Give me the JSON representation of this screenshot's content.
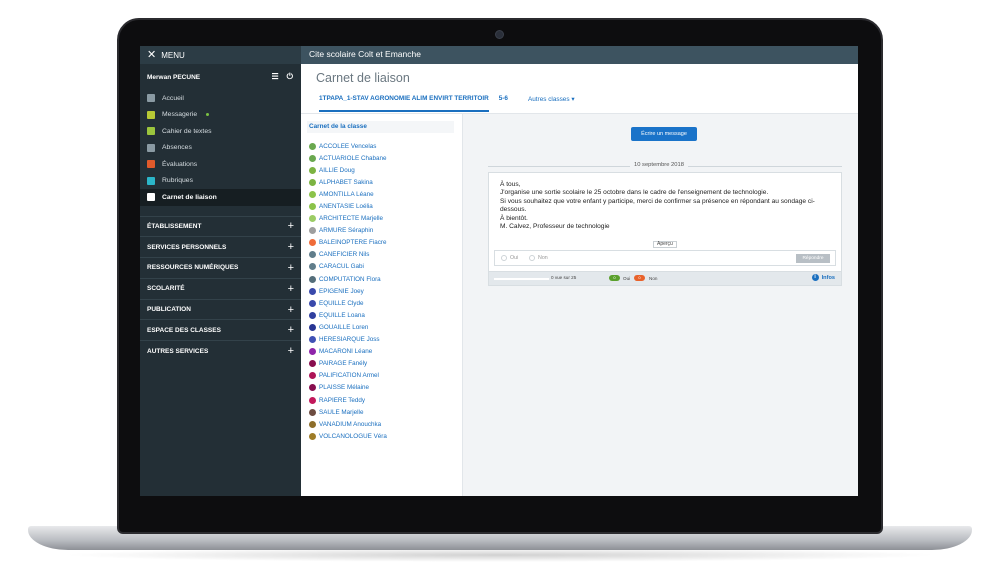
{
  "topbar": {
    "menu_label": "MENU",
    "school_name": "Cite scolaire Colt et Emanche"
  },
  "user": {
    "name": "Merwan PECUNE"
  },
  "nav": [
    {
      "label": "Accueil",
      "icon": "home-icon",
      "color": "#8a9aa3"
    },
    {
      "label": "Messagerie",
      "icon": "mail-icon",
      "color": "#b7c935",
      "new": true
    },
    {
      "label": "Cahier de textes",
      "icon": "book-icon",
      "color": "#9bc53d"
    },
    {
      "label": "Absences",
      "icon": "user-icon",
      "color": "#8a9aa3"
    },
    {
      "label": "Évaluations",
      "icon": "evaluation-icon",
      "color": "#e05a2b"
    },
    {
      "label": "Rubriques",
      "icon": "flag-icon",
      "color": "#2bb6c9"
    },
    {
      "label": "Carnet de liaison",
      "icon": "link-icon",
      "color": "#ffffff",
      "active": true
    }
  ],
  "sections": [
    "ÉTABLISSEMENT",
    "SERVICES PERSONNELS",
    "RESSOURCES NUMÉRIQUES",
    "SCOLARITÉ",
    "PUBLICATION",
    "ESPACE DES CLASSES",
    "AUTRES SERVICES"
  ],
  "header": {
    "title": "Carnet de liaison",
    "tab_class": "1TPAPA_1-STAV AGRONOMIE ALIM ENVIRT TERRITOIR",
    "tab_group": "5-6",
    "other_classes": "Autres classes"
  },
  "student_panel": {
    "class_link": "Carnet de la classe",
    "students": [
      {
        "name": "ACCOLEE Vencelas",
        "color": "#6aa84f"
      },
      {
        "name": "ACTUARIOLE Chabane",
        "color": "#6aa84f"
      },
      {
        "name": "AILLIE Doug",
        "color": "#7cb342"
      },
      {
        "name": "ALPHABET Sakina",
        "color": "#7cb342"
      },
      {
        "name": "AMONTILLA Léane",
        "color": "#8bc34a"
      },
      {
        "name": "ANENTASIE Loélia",
        "color": "#8bc34a"
      },
      {
        "name": "ARCHITECTE Marjelle",
        "color": "#9ccc65"
      },
      {
        "name": "ARMURE Séraphin",
        "color": "#9e9e9e"
      },
      {
        "name": "BALEINOPTERE Fiacre",
        "color": "#ef6c3a"
      },
      {
        "name": "CANEFICIER Nils",
        "color": "#607d8b"
      },
      {
        "name": "CARACUL Gabi",
        "color": "#607d8b"
      },
      {
        "name": "COMPUTATION Flora",
        "color": "#546e7a"
      },
      {
        "name": "EPIGENIE Joey",
        "color": "#3949ab"
      },
      {
        "name": "EQUILLE Clyde",
        "color": "#3949ab"
      },
      {
        "name": "EQUILLE Loana",
        "color": "#303f9f"
      },
      {
        "name": "GOUAILLE Loren",
        "color": "#283593"
      },
      {
        "name": "HERESIARQUE Joss",
        "color": "#3f51b5"
      },
      {
        "name": "MACARONI Léane",
        "color": "#8e24aa"
      },
      {
        "name": "PAIRAGE Fanély",
        "color": "#880e4f"
      },
      {
        "name": "PALIFICATION Armel",
        "color": "#ad1457"
      },
      {
        "name": "PLAISSE Mélaine",
        "color": "#880e4f"
      },
      {
        "name": "RAPIERE Teddy",
        "color": "#c2185b"
      },
      {
        "name": "SAULE Marjelle",
        "color": "#6d4c41"
      },
      {
        "name": "VANADIUM Anouchka",
        "color": "#8d6e2b"
      },
      {
        "name": "VOLCANOLOGUE Véra",
        "color": "#9e7c28"
      }
    ]
  },
  "content": {
    "write_button": "Écrire un message",
    "date": "10 septembre 2018",
    "message_lines": [
      "À tous,",
      "J'organise une sortie scolaire le 25 octobre dans le cadre de l'enseignement de technologie.",
      "Si vous souhaitez que votre enfant y participe, merci de confirmer sa présence en répondant au sondage ci-dessous.",
      "À bientôt.",
      "M. Calvez, Professeur de technologie"
    ],
    "preview_label": "Aperçu",
    "option_yes": "Oui",
    "option_no": "Non",
    "reply_button": "Répondre",
    "read_status": "0 vue sur 25",
    "read_progress": 0,
    "count_yes": "0",
    "count_no": "0",
    "yes_label": "Oui",
    "no_label": "Non",
    "infos_label": "Infos",
    "colors": {
      "yes": "#5aa02c",
      "no": "#e8622b",
      "accent": "#1a73c9"
    }
  }
}
